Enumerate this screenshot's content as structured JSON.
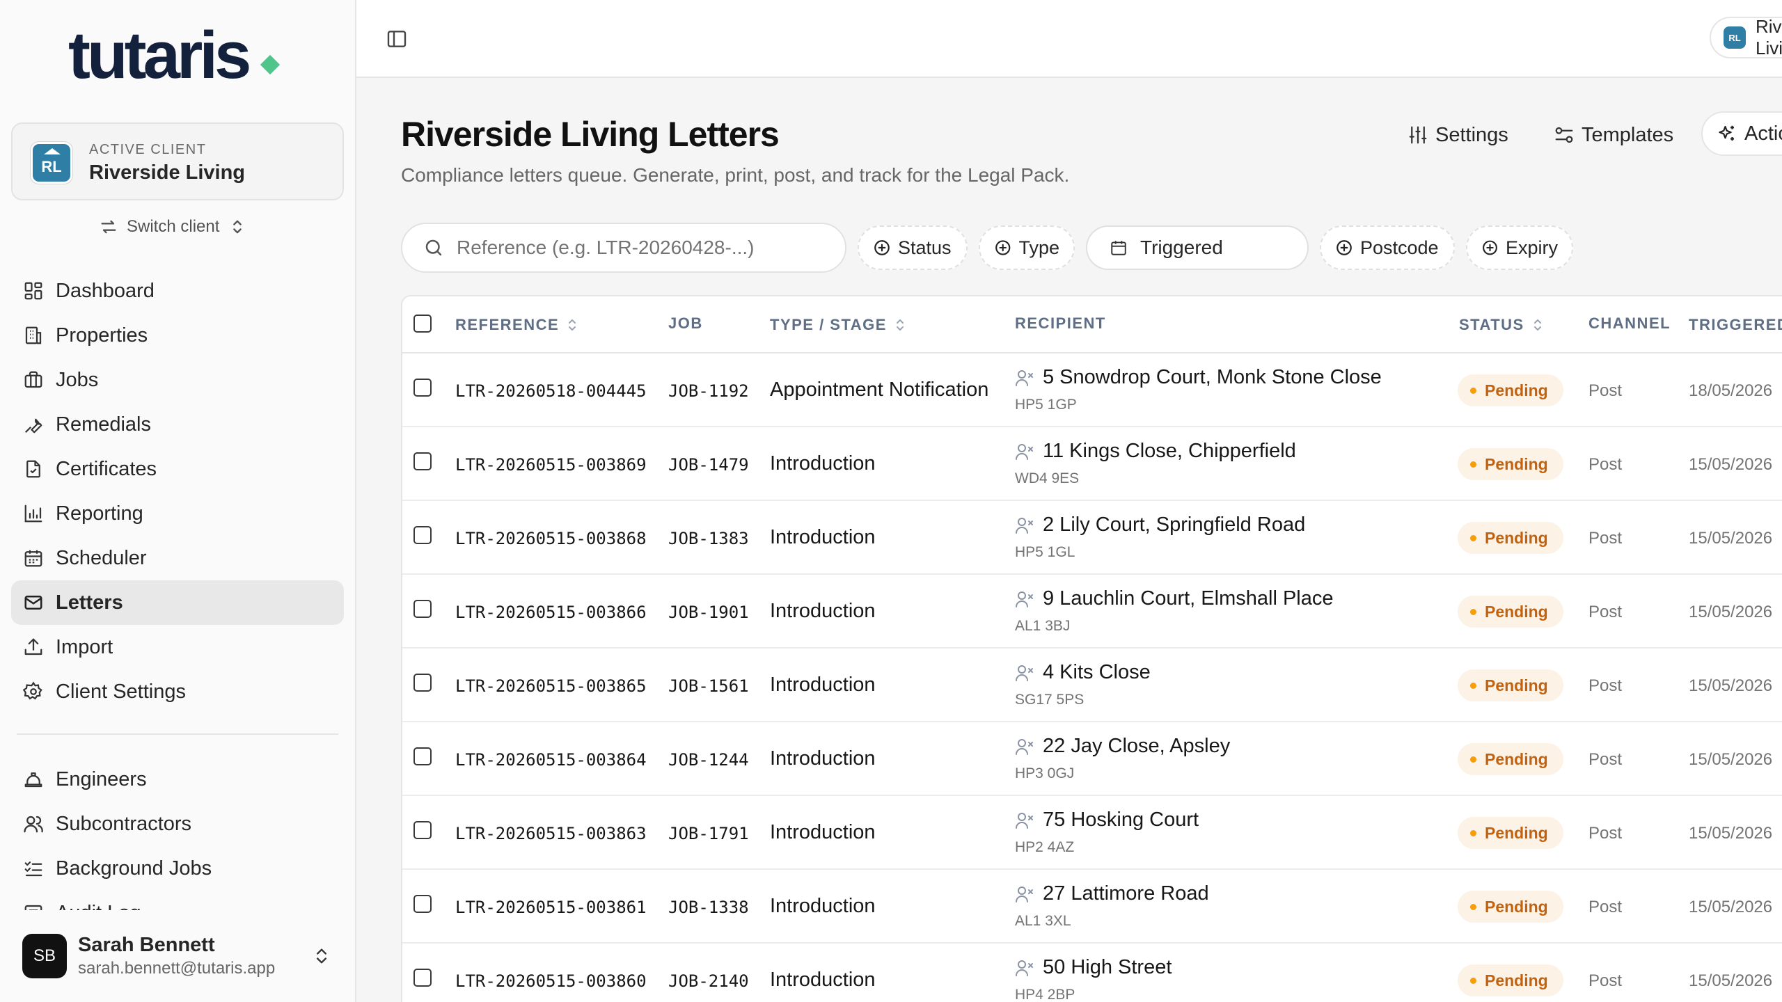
{
  "app": {
    "logo_text": "tutaris"
  },
  "client": {
    "label": "ACTIVE CLIENT",
    "name": "Riverside Living",
    "initials": "RL",
    "switch_label": "Switch client",
    "pill_text": "Riverside Living"
  },
  "nav": {
    "primary": [
      {
        "key": "dashboard",
        "label": "Dashboard",
        "icon": "dashboard-icon",
        "active": false
      },
      {
        "key": "properties",
        "label": "Properties",
        "icon": "building-icon",
        "active": false
      },
      {
        "key": "jobs",
        "label": "Jobs",
        "icon": "briefcase-icon",
        "active": false
      },
      {
        "key": "remedials",
        "label": "Remedials",
        "icon": "wrench-icon",
        "active": false
      },
      {
        "key": "certificates",
        "label": "Certificates",
        "icon": "file-check-icon",
        "active": false
      },
      {
        "key": "reporting",
        "label": "Reporting",
        "icon": "bar-chart-icon",
        "active": false
      },
      {
        "key": "scheduler",
        "label": "Scheduler",
        "icon": "calendar-icon",
        "active": false
      },
      {
        "key": "letters",
        "label": "Letters",
        "icon": "mail-icon",
        "active": true
      },
      {
        "key": "import",
        "label": "Import",
        "icon": "upload-icon",
        "active": false
      },
      {
        "key": "client-settings",
        "label": "Client Settings",
        "icon": "gear-icon",
        "active": false
      }
    ],
    "secondary": [
      {
        "key": "engineers",
        "label": "Engineers",
        "icon": "hard-hat-icon"
      },
      {
        "key": "subcontractors",
        "label": "Subcontractors",
        "icon": "users-icon"
      },
      {
        "key": "background-jobs",
        "label": "Background Jobs",
        "icon": "list-checks-icon"
      },
      {
        "key": "audit-log",
        "label": "Audit Log",
        "icon": "log-icon"
      }
    ]
  },
  "user": {
    "initials": "SB",
    "name": "Sarah Bennett",
    "email": "sarah.bennett@tutaris.app"
  },
  "page": {
    "title": "Riverside Living Letters",
    "subtitle": "Compliance letters queue. Generate, print, post, and track for the Legal Pack."
  },
  "header_actions": {
    "settings": "Settings",
    "templates": "Templates",
    "actions": "Actions"
  },
  "search": {
    "placeholder": "Reference (e.g. LTR-20260428-...)",
    "value": ""
  },
  "filters": {
    "status": "Status",
    "type": "Type",
    "triggered": "Triggered",
    "postcode": "Postcode",
    "expiry": "Expiry"
  },
  "table": {
    "columns": {
      "reference": "REFERENCE",
      "job": "JOB",
      "type_stage": "TYPE / STAGE",
      "recipient": "RECIPIENT",
      "status": "STATUS",
      "channel": "CHANNEL",
      "triggered": "TRIGGERED"
    },
    "rows": [
      {
        "reference": "LTR-20260518-004445",
        "job": "JOB-1192",
        "type": "Appointment Notification",
        "address": "5 Snowdrop Court, Monk Stone Close",
        "postcode": "HP5 1GP",
        "status": "Pending",
        "channel": "Post",
        "triggered": "18/05/2026"
      },
      {
        "reference": "LTR-20260515-003869",
        "job": "JOB-1479",
        "type": "Introduction",
        "address": "11 Kings Close, Chipperfield",
        "postcode": "WD4 9ES",
        "status": "Pending",
        "channel": "Post",
        "triggered": "15/05/2026"
      },
      {
        "reference": "LTR-20260515-003868",
        "job": "JOB-1383",
        "type": "Introduction",
        "address": "2 Lily Court, Springfield Road",
        "postcode": "HP5 1GL",
        "status": "Pending",
        "channel": "Post",
        "triggered": "15/05/2026"
      },
      {
        "reference": "LTR-20260515-003866",
        "job": "JOB-1901",
        "type": "Introduction",
        "address": "9 Lauchlin Court, Elmshall Place",
        "postcode": "AL1 3BJ",
        "status": "Pending",
        "channel": "Post",
        "triggered": "15/05/2026"
      },
      {
        "reference": "LTR-20260515-003865",
        "job": "JOB-1561",
        "type": "Introduction",
        "address": "4 Kits Close",
        "postcode": "SG17 5PS",
        "status": "Pending",
        "channel": "Post",
        "triggered": "15/05/2026"
      },
      {
        "reference": "LTR-20260515-003864",
        "job": "JOB-1244",
        "type": "Introduction",
        "address": "22 Jay Close, Apsley",
        "postcode": "HP3 0GJ",
        "status": "Pending",
        "channel": "Post",
        "triggered": "15/05/2026"
      },
      {
        "reference": "LTR-20260515-003863",
        "job": "JOB-1791",
        "type": "Introduction",
        "address": "75 Hosking Court",
        "postcode": "HP2 4AZ",
        "status": "Pending",
        "channel": "Post",
        "triggered": "15/05/2026"
      },
      {
        "reference": "LTR-20260515-003861",
        "job": "JOB-1338",
        "type": "Introduction",
        "address": "27 Lattimore Road",
        "postcode": "AL1 3XL",
        "status": "Pending",
        "channel": "Post",
        "triggered": "15/05/2026"
      },
      {
        "reference": "LTR-20260515-003860",
        "job": "JOB-2140",
        "type": "Introduction",
        "address": "50 High Street",
        "postcode": "HP4 2BP",
        "status": "Pending",
        "channel": "Post",
        "triggered": "15/05/2026"
      }
    ]
  },
  "colors": {
    "brand_dark": "#14213d",
    "brand_accent": "#4fc48b",
    "client_blue": "#2f7ea6",
    "pending_bg": "#fdf2e6",
    "pending_text": "#c2620e",
    "pending_dot": "#f59e0b"
  }
}
